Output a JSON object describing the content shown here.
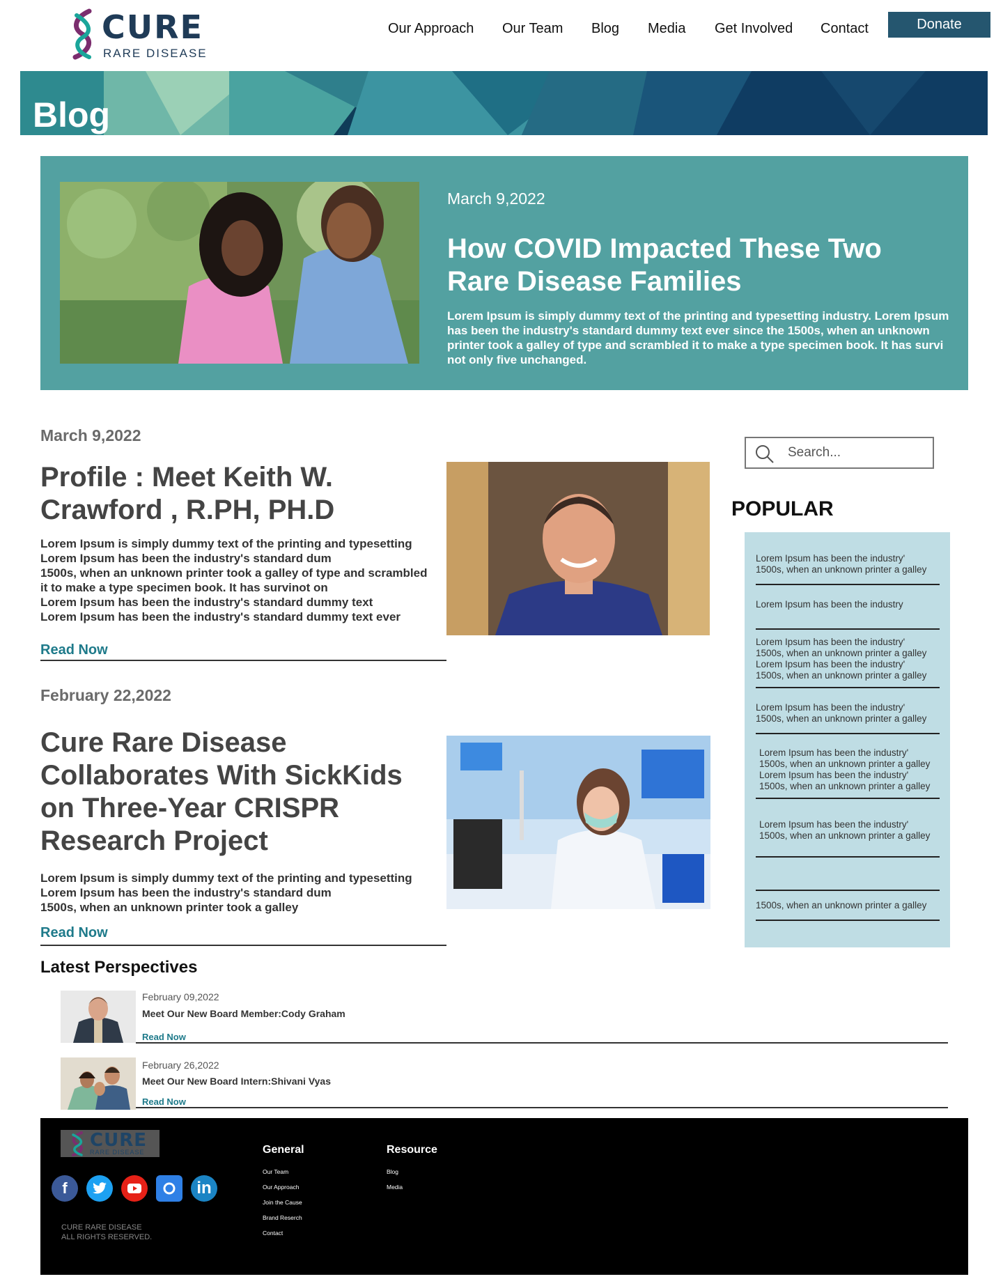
{
  "brand": {
    "name": "CURE",
    "tagline": "RARE DISEASE"
  },
  "nav": {
    "items": [
      "Our Approach",
      "Our Team",
      "Blog",
      "Media",
      "Get Involved",
      "Contact"
    ],
    "donate": "Donate"
  },
  "hero": {
    "title": "Blog"
  },
  "featured": {
    "date": "March 9,2022",
    "title": "How COVID Impacted These Two Rare Disease Families",
    "text": "Lorem Ipsum is simply dummy text of the printing and typesetting industry. Lorem Ipsum has been the industry's standard dummy text ever since the 1500s, when an unknown printer took a galley of type and scrambled it to make a type specimen book. It has survi not only five unchanged."
  },
  "posts": [
    {
      "date": "March 9,2022",
      "title": "Profile : Meet Keith W. Crawford , R.PH, PH.D",
      "text": "Lorem Ipsum is simply dummy text of the printing and typesetting\nLorem Ipsum has been the industry's standard dum\n1500s, when an unknown printer took a galley of type and scrambled\n it to make a type specimen book. It has survinot on\nLorem Ipsum has been the industry's standard dummy text\nLorem Ipsum has been the industry's standard dummy text ever",
      "read": "Read Now"
    },
    {
      "date": "February 22,2022",
      "title": "Cure Rare Disease Collaborates With SickKids on Three-Year CRISPR Research Project",
      "text": "Lorem Ipsum is simply dummy text of the printing and typesetting\nLorem Ipsum has been the industry's standard dum\n1500s, when an unknown printer took a galley",
      "read": "Read Now"
    }
  ],
  "sidebar": {
    "search_placeholder": "Search...",
    "popular_heading": "POPULAR",
    "popular": [
      "Lorem Ipsum has been the industry'\n1500s, when an unknown printer a galley",
      "Lorem Ipsum has been the industry",
      "Lorem Ipsum has been the industry'\n1500s, when an unknown printer a galley\nLorem Ipsum has been the industry'\n1500s, when an unknown printer a galley",
      "Lorem Ipsum has been the industry'\n1500s, when an unknown printer a galley",
      "Lorem Ipsum has been the industry'\n1500s, when an unknown printer a galley\nLorem Ipsum has been the industry'\n1500s, when an unknown printer a galley",
      "Lorem Ipsum has been the industry'\n1500s, when an unknown printer a galley",
      "",
      "1500s, when an unknown printer a galley"
    ]
  },
  "latest": {
    "heading": "Latest Perspectives",
    "items": [
      {
        "date": "February 09,2022",
        "title": "Meet Our New Board Member:Cody Graham",
        "read": "Read Now"
      },
      {
        "date": "February 26,2022",
        "title": "Meet Our New Board Intern:Shivani Vyas",
        "read": "Read Now"
      }
    ]
  },
  "footer": {
    "general_heading": "General",
    "general": [
      "Our Team",
      "Our Approach",
      "Join the Cause",
      "Brand Reserch",
      "Contact"
    ],
    "resource_heading": "Resource",
    "resource": [
      "Blog",
      "Media"
    ],
    "copyright": "CURE RARE DISEASE\nALL RIGHTS RESERVED.",
    "social_icons": [
      "facebook-icon",
      "twitter-icon",
      "youtube-icon",
      "instagram-icon",
      "linkedin-icon"
    ],
    "social_glyphs": {
      "facebook": "f",
      "linkedin": "in"
    }
  },
  "colors": {
    "accent": "#25566f",
    "teal": "#53a1a1",
    "popular_bg": "#bfdde4",
    "link": "#1e7a8a"
  }
}
